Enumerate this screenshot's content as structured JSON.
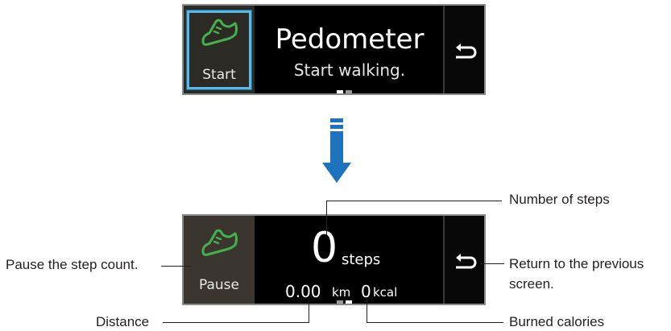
{
  "top_screen": {
    "button_label": "Start",
    "title": "Pedometer",
    "subtitle": "Start walking."
  },
  "bottom_screen": {
    "button_label": "Pause",
    "steps_value": "0",
    "steps_unit": "steps",
    "distance_value": "0.00",
    "distance_unit": "km",
    "calories_value": "0",
    "calories_unit": "kcal"
  },
  "callouts": {
    "number_of_steps": "Number of steps",
    "pause_count": "Pause the step count.",
    "return_line1": "Return to the previous",
    "return_line2": "screen.",
    "distance": "Distance",
    "burned_calories": "Burned calories"
  },
  "colors": {
    "shoe_green": "#45b14a",
    "arrow_blue": "#1e73be",
    "selection_blue": "#58b8e8"
  },
  "icons": [
    "shoe-icon",
    "back-icon",
    "down-arrow-icon"
  ]
}
